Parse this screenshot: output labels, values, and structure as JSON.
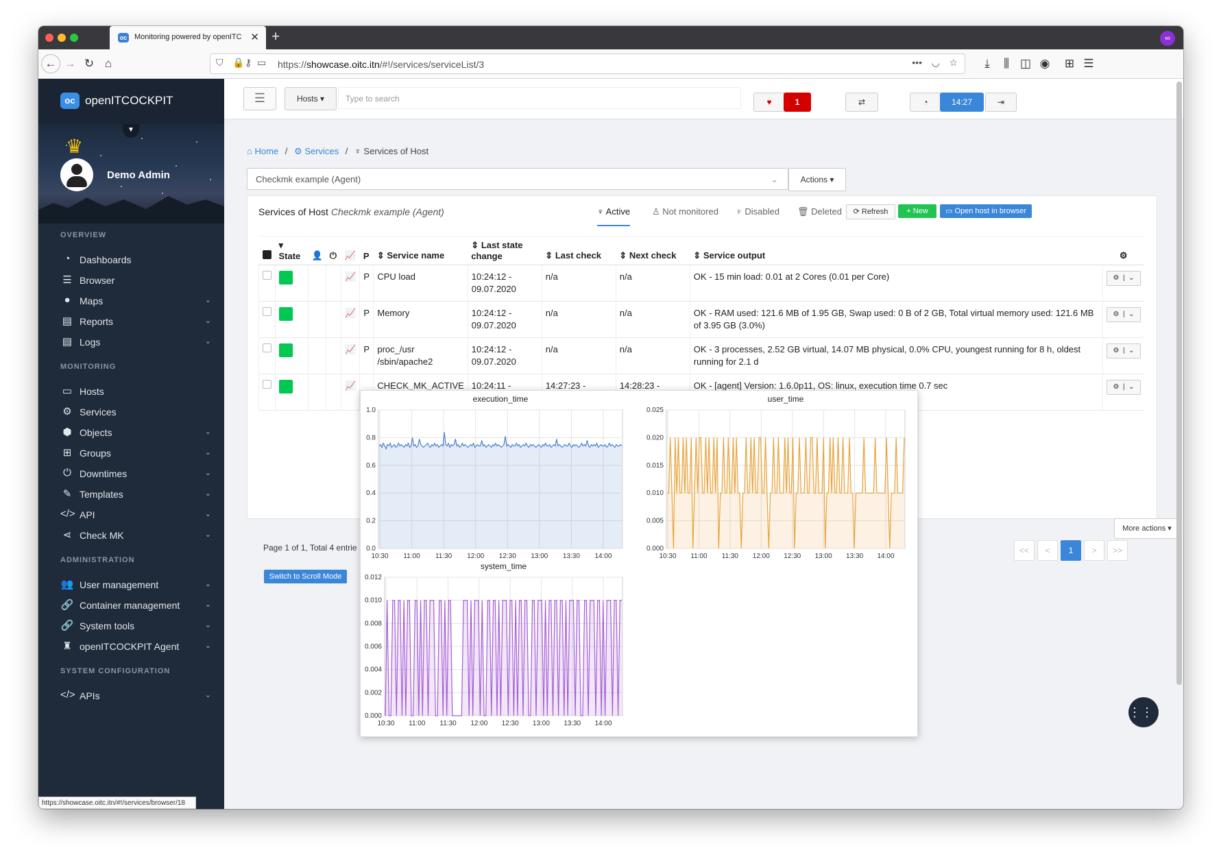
{
  "browser": {
    "tab_title": "Monitoring powered by openITC",
    "url_prefix": "https://",
    "url_host": "showcase.oitc.itn",
    "url_path": "/#!/services/serviceList/3",
    "status_url": "https://showcase.oitc.itn/#!/services/browser/18"
  },
  "sidebar": {
    "brand": "openITCOCKPIT",
    "brand_logo": "oc",
    "user_name": "Demo Admin",
    "sections": [
      {
        "title": "OVERVIEW",
        "items": [
          {
            "label": "Dashboards",
            "icon": "dashboard-icon",
            "glyph": "◔",
            "dropdown": false
          },
          {
            "label": "Browser",
            "icon": "list-icon",
            "glyph": "☰",
            "dropdown": false
          },
          {
            "label": "Maps",
            "icon": "map-marker-icon",
            "glyph": "●",
            "dropdown": true
          },
          {
            "label": "Reports",
            "icon": "file-icon",
            "glyph": "▤",
            "dropdown": true
          },
          {
            "label": "Logs",
            "icon": "file-text-icon",
            "glyph": "▤",
            "dropdown": true
          }
        ]
      },
      {
        "title": "MONITORING",
        "items": [
          {
            "label": "Hosts",
            "icon": "desktop-icon",
            "glyph": "▭",
            "dropdown": false
          },
          {
            "label": "Services",
            "icon": "cogs-icon",
            "glyph": "⚙",
            "dropdown": false
          },
          {
            "label": "Objects",
            "icon": "cubes-icon",
            "glyph": "⬢",
            "dropdown": true
          },
          {
            "label": "Groups",
            "icon": "sitemap-icon",
            "glyph": "⊞",
            "dropdown": true
          },
          {
            "label": "Downtimes",
            "icon": "power-icon",
            "glyph": "⏻",
            "dropdown": true
          },
          {
            "label": "Templates",
            "icon": "edit-icon",
            "glyph": "✎",
            "dropdown": true
          },
          {
            "label": "API",
            "icon": "code-icon",
            "glyph": "</>",
            "dropdown": true
          },
          {
            "label": "Check MK",
            "icon": "share-icon",
            "glyph": "⋖",
            "dropdown": true
          }
        ]
      },
      {
        "title": "ADMINISTRATION",
        "items": [
          {
            "label": "User management",
            "icon": "users-icon",
            "glyph": "👥",
            "dropdown": true
          },
          {
            "label": "Container management",
            "icon": "link-icon",
            "glyph": "🔗",
            "dropdown": true
          },
          {
            "label": "System tools",
            "icon": "link-icon",
            "glyph": "🔗",
            "dropdown": true
          },
          {
            "label": "openITCOCKPIT Agent",
            "icon": "user-secret-icon",
            "glyph": "♜",
            "dropdown": true
          }
        ]
      },
      {
        "title": "SYSTEM CONFIGURATION",
        "items": [
          {
            "label": "APIs",
            "icon": "code-icon",
            "glyph": "</>",
            "dropdown": true
          }
        ]
      }
    ]
  },
  "topbar": {
    "hosts_select": "Hosts",
    "search_placeholder": "Type to search",
    "alert_count": "1",
    "time": "14:27"
  },
  "breadcrumb": {
    "home": "Home",
    "services": "Services",
    "current": "Services of Host"
  },
  "host_select": {
    "value": "Checkmk example (Agent)",
    "actions_label": "Actions"
  },
  "panel": {
    "title": "Services of Host",
    "host_name": "Checkmk example (Agent)",
    "tabs": [
      {
        "label": "Active",
        "active": true
      },
      {
        "label": "Not monitored",
        "active": false
      },
      {
        "label": "Disabled",
        "active": false
      },
      {
        "label": "Deleted",
        "active": false
      }
    ],
    "buttons": {
      "refresh": "Refresh",
      "new": "New",
      "open_host": "Open host in browser"
    },
    "columns": {
      "state": "State",
      "p": "P",
      "service_name": "Service name",
      "last_state_change": "Last state change",
      "last_check": "Last check",
      "next_check": "Next check",
      "service_output": "Service output"
    },
    "rows": [
      {
        "name": "CPU load",
        "p": "P",
        "last_state_change": "10:24:12 - 09.07.2020",
        "last_check": "n/a",
        "next_check": "n/a",
        "output": "OK - 15 min load: 0.01 at 2 Cores (0.01 per Core)",
        "state_color": "#00c853"
      },
      {
        "name": "Memory",
        "p": "P",
        "last_state_change": "10:24:12 - 09.07.2020",
        "last_check": "n/a",
        "next_check": "n/a",
        "output": "OK - RAM used: 121.6 MB of 1.95 GB, Swap used: 0 B of 2 GB, Total virtual memory used: 121.6 MB of 3.95 GB (3.0%)",
        "state_color": "#00c853"
      },
      {
        "name": "proc_/usr /sbin/apache2",
        "p": "P",
        "last_state_change": "10:24:12 - 09.07.2020",
        "last_check": "n/a",
        "next_check": "n/a",
        "output": "OK - 3 processes, 2.52 GB virtual, 14.07 MB physical, 0.0% CPU, youngest running for 8 h, oldest running for 2.1 d",
        "state_color": "#00c853"
      },
      {
        "name": "CHECK_MK_ACTIVE",
        "p": "",
        "last_state_change": "10:24:11 - 09.07.2020",
        "last_check": "14:27:23 - 10.07.2020",
        "next_check": "14:28:23 - 10.07.2020",
        "output": "OK - [agent] Version: 1.6.0p11, OS: linux, execution time 0.7 sec",
        "state_color": "#00c853"
      }
    ],
    "page_info": "Page 1 of 1, Total 4 entrie",
    "scroll_mode": "Switch to Scroll Mode",
    "more_actions": "More actions",
    "pagination": [
      "<<",
      "<",
      "1",
      ">",
      ">>"
    ]
  },
  "colors": {
    "accent": "#3a86d8",
    "sidebar": "#1f2a3a",
    "ok": "#00c853",
    "danger": "#d40000",
    "success_btn": "#21c353"
  },
  "chart_data": [
    {
      "type": "area",
      "title": "execution_time",
      "x_ticks": [
        "10:30",
        "11:00",
        "11:30",
        "12:00",
        "12:30",
        "13:00",
        "13:30",
        "14:00"
      ],
      "ylim": [
        0.0,
        1.0
      ],
      "y_ticks": [
        "0.0",
        "0.2",
        "0.4",
        "0.6",
        "0.8",
        "1.0"
      ],
      "grid": true,
      "color": "#4a7fd0",
      "values": [
        0.74,
        0.75,
        0.73,
        0.76,
        0.74,
        0.72,
        0.75,
        0.74,
        0.76,
        0.73,
        0.74,
        0.75,
        0.73,
        0.74,
        0.76,
        0.74,
        0.75,
        0.74,
        0.73,
        0.75,
        0.74,
        0.76,
        0.73,
        0.74,
        0.8,
        0.74,
        0.75,
        0.73,
        0.74,
        0.79,
        0.75,
        0.74,
        0.73,
        0.74,
        0.75,
        0.76,
        0.74,
        0.73,
        0.75,
        0.74,
        0.76,
        0.74,
        0.75,
        0.73,
        0.74,
        0.75,
        0.74,
        0.84,
        0.75,
        0.74,
        0.76,
        0.73,
        0.75,
        0.74,
        0.75,
        0.79,
        0.74,
        0.75,
        0.73,
        0.74,
        0.76,
        0.74,
        0.75,
        0.74,
        0.73,
        0.74,
        0.75,
        0.74,
        0.76,
        0.73,
        0.74,
        0.75,
        0.74,
        0.74,
        0.78,
        0.74,
        0.75,
        0.73,
        0.74,
        0.75,
        0.74,
        0.73,
        0.75,
        0.74,
        0.76,
        0.74,
        0.75,
        0.74,
        0.73,
        0.74,
        0.75,
        0.81,
        0.74,
        0.75,
        0.74,
        0.73,
        0.75,
        0.74,
        0.74,
        0.76,
        0.74,
        0.75,
        0.73,
        0.74,
        0.75,
        0.74,
        0.76,
        0.74,
        0.73,
        0.75,
        0.74,
        0.75,
        0.74,
        0.73,
        0.74,
        0.75,
        0.74,
        0.73,
        0.75,
        0.74,
        0.76,
        0.74,
        0.74,
        0.75,
        0.73,
        0.74,
        0.75,
        0.74,
        0.79,
        0.74,
        0.75,
        0.74,
        0.73,
        0.74,
        0.75,
        0.74,
        0.74,
        0.76,
        0.74,
        0.73,
        0.75,
        0.74,
        0.75,
        0.74,
        0.73,
        0.74,
        0.76,
        0.74,
        0.75,
        0.74,
        0.78,
        0.74,
        0.73,
        0.75,
        0.74,
        0.75,
        0.74,
        0.76,
        0.73,
        0.74,
        0.75,
        0.74,
        0.74,
        0.75,
        0.73,
        0.74,
        0.76,
        0.74,
        0.75,
        0.74,
        0.73,
        0.75,
        0.74,
        0.74,
        0.75,
        0.74
      ]
    },
    {
      "type": "area",
      "title": "user_time",
      "x_ticks": [
        "10:30",
        "11:00",
        "11:30",
        "12:00",
        "12:30",
        "13:00",
        "13:30",
        "14:00"
      ],
      "ylim": [
        0.0,
        0.025
      ],
      "y_ticks": [
        "0.000",
        "0.005",
        "0.010",
        "0.015",
        "0.020",
        "0.025"
      ],
      "grid": true,
      "color": "#e8a33d",
      "values": [
        0.01,
        0.01,
        0.02,
        0.01,
        0,
        0.02,
        0.01,
        0.02,
        0.01,
        0.01,
        0.02,
        0.01,
        0.02,
        0.01,
        0.01,
        0.02,
        0,
        0.01,
        0.02,
        0.01,
        0.02,
        0.02,
        0.01,
        0.01,
        0.02,
        0.01,
        0.02,
        0.01,
        0.01,
        0.02,
        0.01,
        0.02,
        0,
        0.01,
        0.01,
        0.02,
        0.01,
        0.01,
        0.02,
        0.01,
        0.01,
        0.02,
        0.01,
        0.02,
        0.01,
        0.01,
        0,
        0.01,
        0.01,
        0.02,
        0.01,
        0.01,
        0.02,
        0.01,
        0.02,
        0.01,
        0.01,
        0.02,
        0.02,
        0.01,
        0.01,
        0.02,
        0.01,
        0,
        0.01,
        0.01,
        0.02,
        0.01,
        0.01,
        0.02,
        0.01,
        0.01,
        0.01,
        0.02,
        0.01,
        0.02,
        0.01,
        0.01,
        0.02,
        0,
        0.01,
        0.01,
        0.02,
        0.01,
        0.01,
        0.01,
        0.02,
        0.01,
        0.01,
        0.02,
        0.02,
        0.01,
        0.01,
        0.02,
        0.01,
        0.01,
        0.01,
        0.02,
        0,
        0.01,
        0.01,
        0.02,
        0.01,
        0.02,
        0.01,
        0.01,
        0.02,
        0.01,
        0.01,
        0.02,
        0.01,
        0.01,
        0.01,
        0.02,
        0.01,
        0.01,
        0,
        0.01,
        0.01,
        0.01,
        0.01,
        0.01,
        0.02,
        0.01,
        0.01,
        0.01,
        0.01,
        0.01,
        0.01,
        0.02,
        0.01,
        0.01,
        0.01,
        0.01,
        0.01,
        0.01,
        0.02,
        0.01,
        0,
        0.01,
        0.01,
        0.01,
        0.02,
        0.01,
        0.01,
        0.01,
        0.01,
        0.02
      ]
    },
    {
      "type": "area",
      "title": "system_time",
      "x_ticks": [
        "10:30",
        "11:00",
        "11:30",
        "12:00",
        "12:30",
        "13:00",
        "13:30",
        "14:00"
      ],
      "ylim": [
        0.0,
        0.012
      ],
      "y_ticks": [
        "0.000",
        "0.002",
        "0.004",
        "0.006",
        "0.008",
        "0.010",
        "0.012"
      ],
      "grid": true,
      "color": "#a55cd6",
      "values": [
        0,
        0.01,
        0,
        0,
        0.01,
        0.01,
        0,
        0.01,
        0.01,
        0,
        0.01,
        0,
        0.01,
        0.01,
        0,
        0,
        0.01,
        0.01,
        0,
        0.01,
        0,
        0.01,
        0.01,
        0,
        0.01,
        0.01,
        0.01,
        0,
        0,
        0.01,
        0.01,
        0,
        0.01,
        0,
        0.01,
        0.01,
        0,
        0,
        0,
        0,
        0,
        0,
        0.01,
        0.01,
        0.01,
        0,
        0.01,
        0,
        0.01,
        0.01,
        0.01,
        0,
        0.01,
        0,
        0,
        0.01,
        0.01,
        0,
        0.01,
        0.01,
        0,
        0.01,
        0,
        0.01,
        0.01,
        0.01,
        0,
        0.01,
        0.01,
        0,
        0.01,
        0,
        0.01,
        0.01,
        0,
        0.01,
        0.01,
        0,
        0,
        0.01,
        0.01,
        0,
        0.01,
        0.01,
        0.01,
        0,
        0.01,
        0,
        0.01,
        0.01,
        0,
        0.01,
        0.01,
        0,
        0.01,
        0.01,
        0,
        0.01,
        0,
        0.01,
        0.01,
        0.01,
        0,
        0.01,
        0.01,
        0,
        0,
        0.01,
        0.01,
        0,
        0.01,
        0.01,
        0.01,
        0,
        0.01,
        0.01,
        0,
        0.01,
        0,
        0.01,
        0.01,
        0.01,
        0,
        0.01,
        0.01,
        0,
        0.01,
        0.01
      ]
    }
  ]
}
